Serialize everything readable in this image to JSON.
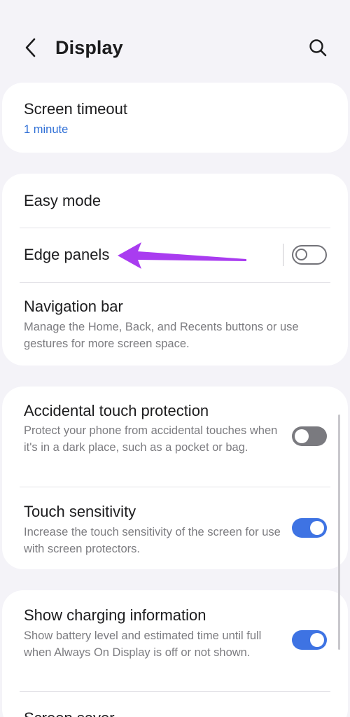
{
  "header": {
    "title": "Display",
    "back_icon": "chevron-left-icon",
    "search_icon": "search-icon"
  },
  "sections": {
    "screen_timeout": {
      "title": "Screen timeout",
      "value": "1 minute"
    },
    "easy_mode": {
      "title": "Easy mode"
    },
    "edge_panels": {
      "title": "Edge panels",
      "toggle": "off"
    },
    "navigation_bar": {
      "title": "Navigation bar",
      "subtitle": "Manage the Home, Back, and Recents buttons or use gestures for more screen space."
    },
    "accidental_touch": {
      "title": "Accidental touch protection",
      "subtitle": "Protect your phone from accidental touches when it's in a dark place, such as a pocket or bag.",
      "toggle": "off"
    },
    "touch_sensitivity": {
      "title": "Touch sensitivity",
      "subtitle": "Increase the touch sensitivity of the screen for use with screen protectors.",
      "toggle": "on"
    },
    "charging_info": {
      "title": "Show charging information",
      "subtitle": "Show battery level and estimated time until full when Always On Display is off or not shown.",
      "toggle": "on"
    },
    "screen_saver": {
      "title": "Screen saver"
    }
  },
  "colors": {
    "background": "#f4f3f8",
    "card": "#ffffff",
    "accent_blue": "#3e73e3",
    "link_blue": "#2f6fd6",
    "annotation_arrow": "#a93cf0"
  }
}
